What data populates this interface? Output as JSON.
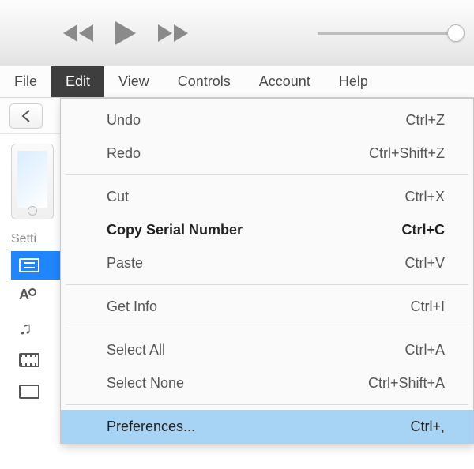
{
  "menubar": {
    "items": [
      "File",
      "Edit",
      "View",
      "Controls",
      "Account",
      "Help"
    ],
    "active_index": 1
  },
  "sidebar": {
    "settings_label": "Setti"
  },
  "edit_menu": {
    "groups": [
      [
        {
          "label": "Undo",
          "shortcut": "Ctrl+Z",
          "bold": false,
          "highlight": false
        },
        {
          "label": "Redo",
          "shortcut": "Ctrl+Shift+Z",
          "bold": false,
          "highlight": false
        }
      ],
      [
        {
          "label": "Cut",
          "shortcut": "Ctrl+X",
          "bold": false,
          "highlight": false
        },
        {
          "label": "Copy Serial Number",
          "shortcut": "Ctrl+C",
          "bold": true,
          "highlight": false
        },
        {
          "label": "Paste",
          "shortcut": "Ctrl+V",
          "bold": false,
          "highlight": false
        }
      ],
      [
        {
          "label": "Get Info",
          "shortcut": "Ctrl+I",
          "bold": false,
          "highlight": false
        }
      ],
      [
        {
          "label": "Select All",
          "shortcut": "Ctrl+A",
          "bold": false,
          "highlight": false
        },
        {
          "label": "Select None",
          "shortcut": "Ctrl+Shift+A",
          "bold": false,
          "highlight": false
        }
      ],
      [
        {
          "label": "Preferences...",
          "shortcut": "Ctrl+,",
          "bold": false,
          "highlight": true
        }
      ]
    ]
  }
}
